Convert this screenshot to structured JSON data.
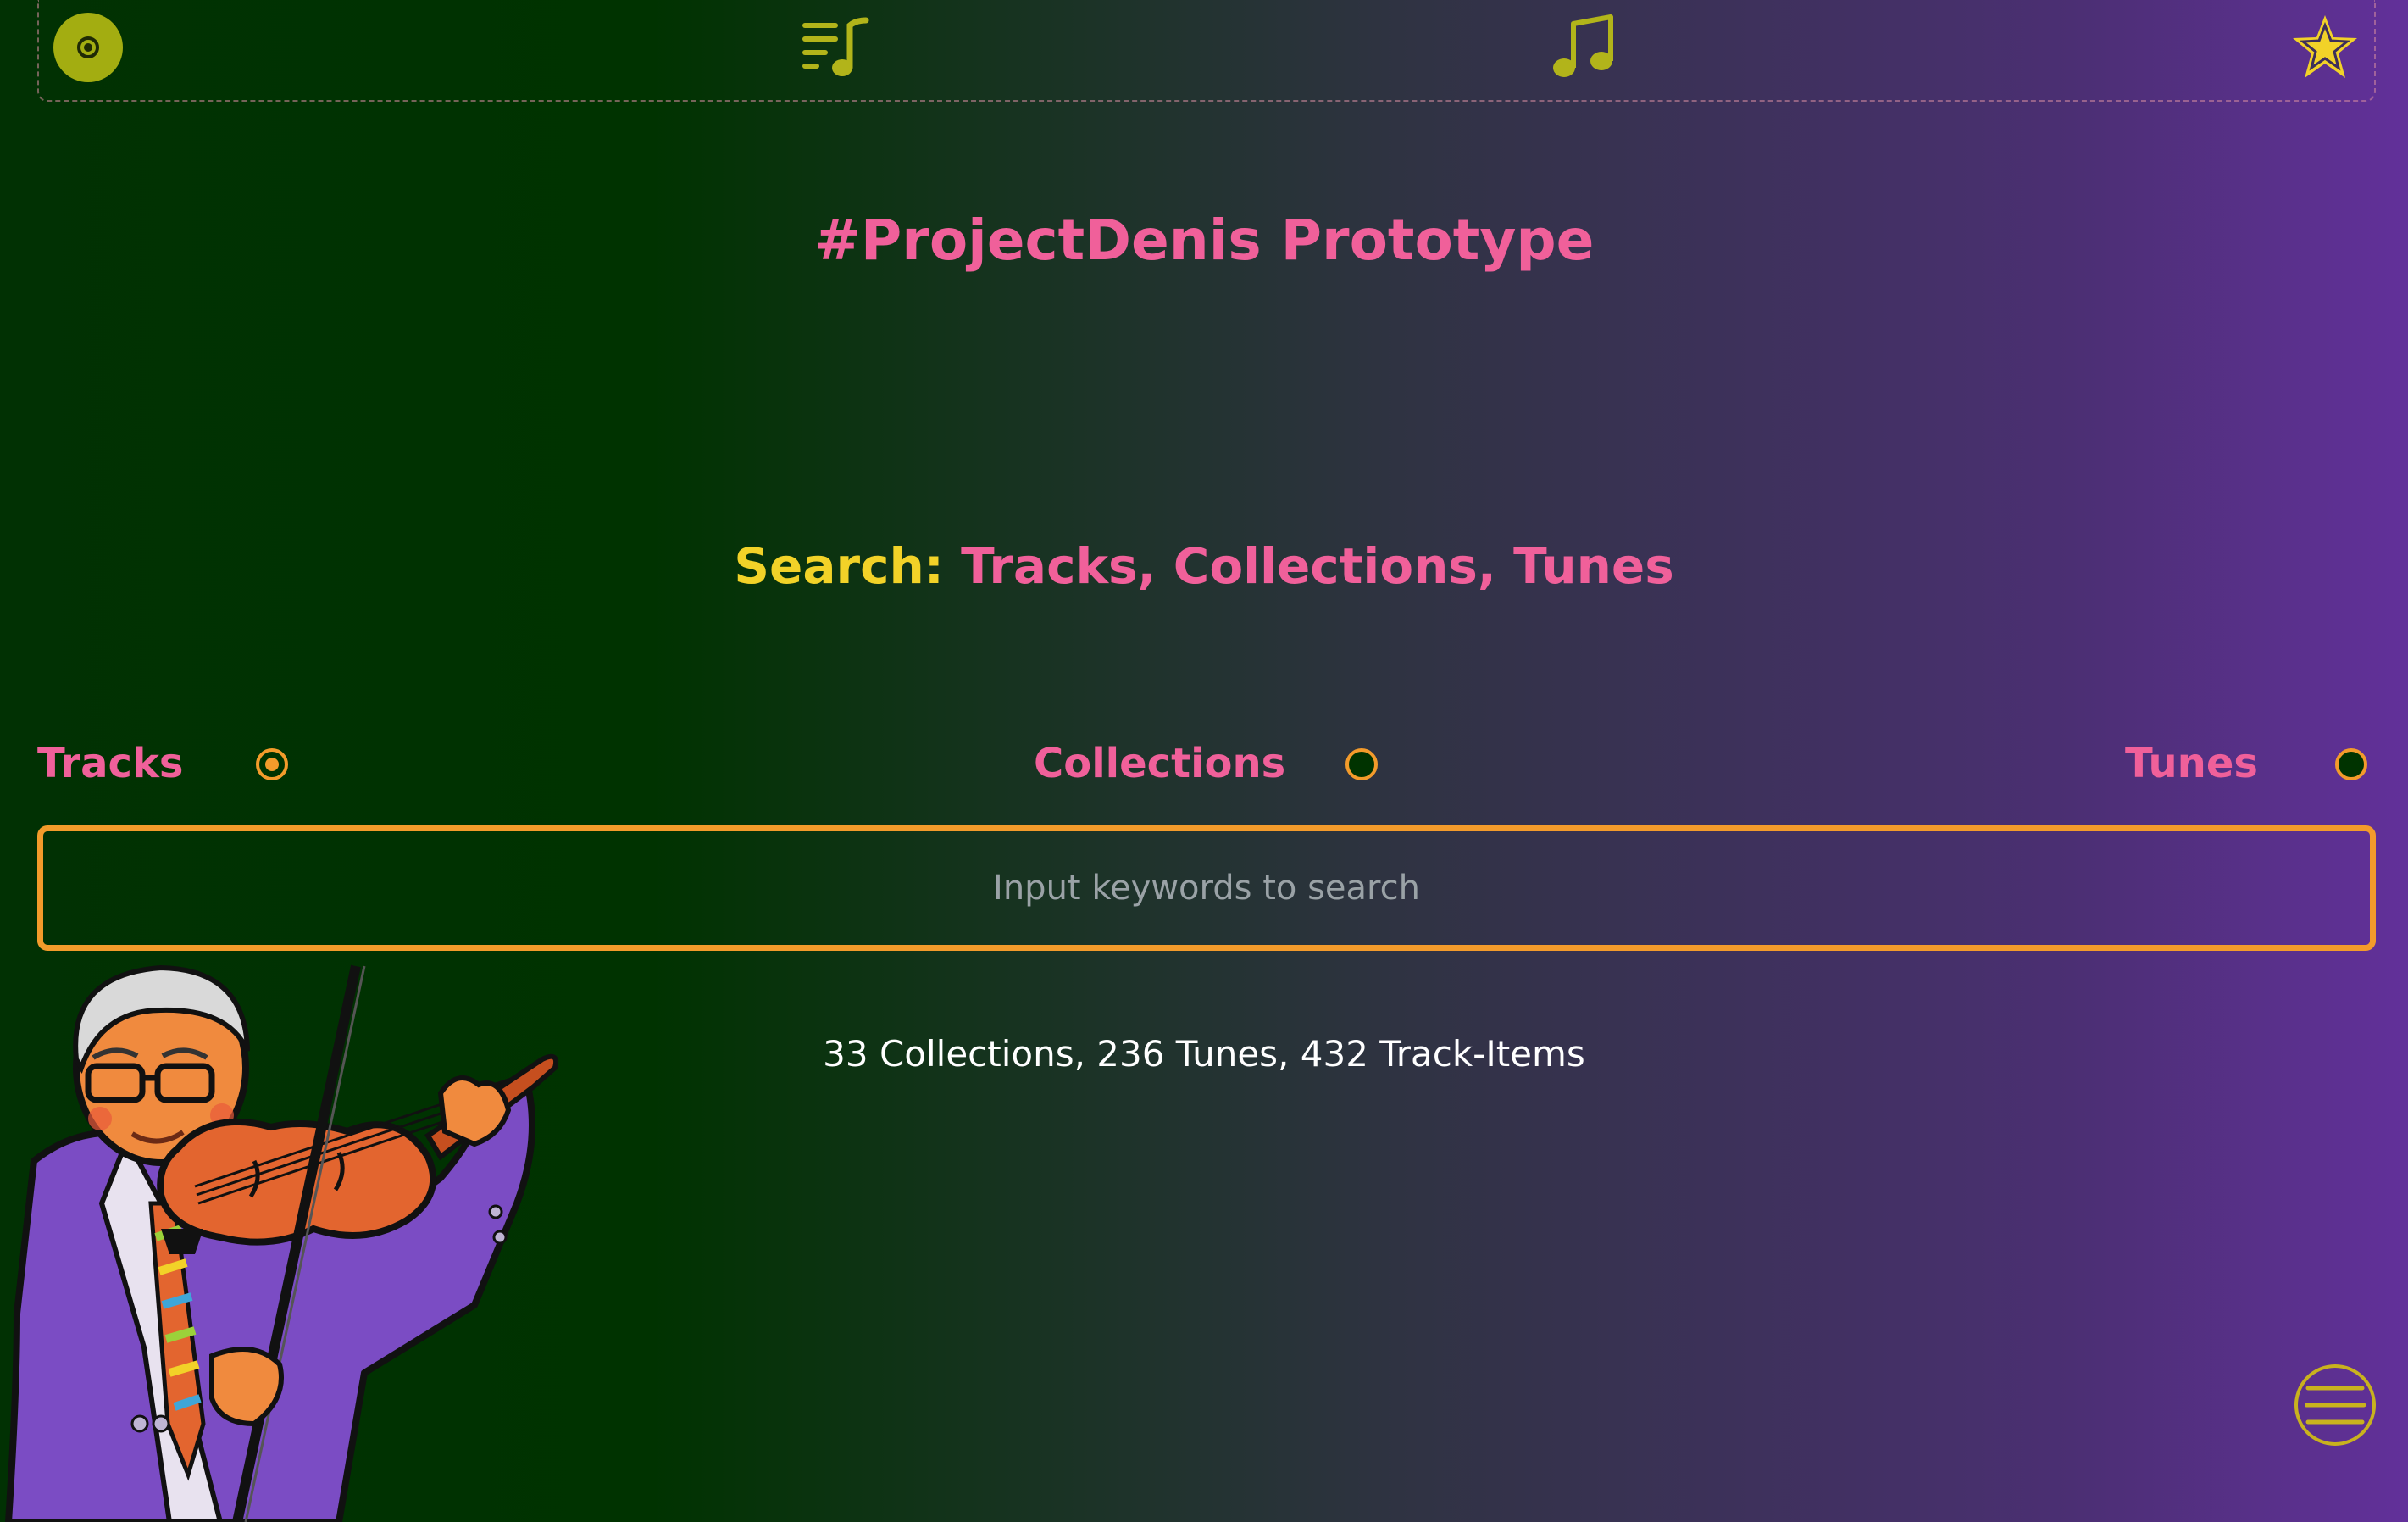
{
  "nav": {
    "items": [
      {
        "name": "disc",
        "icon": "disc-icon"
      },
      {
        "name": "playlist",
        "icon": "playlist-music-icon"
      },
      {
        "name": "note",
        "icon": "music-note-icon"
      },
      {
        "name": "favourites",
        "icon": "star-icon"
      }
    ]
  },
  "header": {
    "title": "#ProjectDenis Prototype"
  },
  "search": {
    "heading_lead": "Search:",
    "heading_rest": " Tracks, Collections, Tunes",
    "options": [
      {
        "label": "Tracks",
        "selected": true
      },
      {
        "label": "Collections",
        "selected": false
      },
      {
        "label": "Tunes",
        "selected": false
      }
    ],
    "placeholder": "Input keywords to search",
    "value": ""
  },
  "stats": {
    "text": "33 Collections, 236 Tunes, 432 Track-Items"
  },
  "menu": {
    "icon": "hamburger-menu-icon"
  },
  "colors": {
    "accent_pink": "#f0609a",
    "accent_yellow": "#f2d228",
    "accent_orange": "#f39b2b",
    "icon_olive": "#b2b41a"
  }
}
